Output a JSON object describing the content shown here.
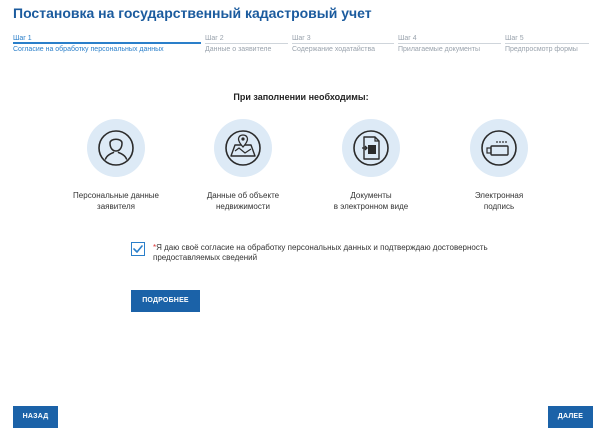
{
  "header": {
    "title": "Постановка на государственный кадастровый учет"
  },
  "steps": [
    {
      "num": "Шаг 1",
      "label": "Согласие на обработку персональных данных",
      "active": true
    },
    {
      "num": "Шаг 2",
      "label": "Данные о заявителе",
      "active": false
    },
    {
      "num": "Шаг 3",
      "label": "Содержание ходатайства",
      "active": false
    },
    {
      "num": "Шаг 4",
      "label": "Прилагаемые документы",
      "active": false
    },
    {
      "num": "Шаг 5",
      "label": "Предпросмотр формы",
      "active": false
    }
  ],
  "requirements": {
    "heading": "При заполнении необходимы:",
    "items": [
      {
        "icon": "person-icon",
        "line1": "Персональные данные",
        "line2": "заявителя"
      },
      {
        "icon": "property-map-icon",
        "line1": "Данные об объекте",
        "line2": "недвижимости"
      },
      {
        "icon": "document-icon",
        "line1": "Документы",
        "line2": "в электронном виде"
      },
      {
        "icon": "usb-token-icon",
        "line1": "Электронная",
        "line2": "подпись"
      }
    ]
  },
  "consent": {
    "checked": true,
    "star": "*",
    "text": "Я даю своё согласие на обработку персональных данных и подтверждаю достоверность предоставляемых сведений"
  },
  "buttons": {
    "more": "ПОДРОБНЕЕ",
    "back": "НАЗАД",
    "next": "ДАЛЕЕ"
  },
  "colors": {
    "primary": "#1b62a8",
    "accent": "#2a7fca",
    "icon_bg": "#ddeaf6"
  }
}
